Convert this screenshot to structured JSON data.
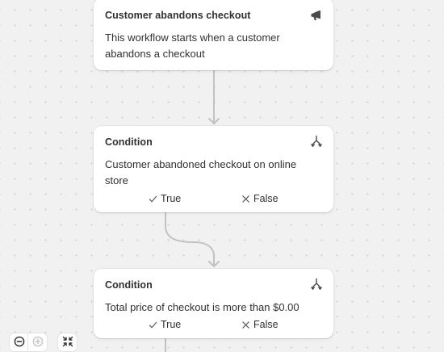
{
  "workflow": {
    "trigger": {
      "title": "Customer abandons checkout",
      "description": "This workflow starts when a customer abandons a checkout",
      "icon": "megaphone-icon"
    },
    "conditions": [
      {
        "title": "Condition",
        "description": "Customer abandoned checkout on online store",
        "icon": "branch-icon",
        "true_label": "True",
        "false_label": "False"
      },
      {
        "title": "Condition",
        "description": "Total price of checkout is more than $0.00",
        "icon": "branch-icon",
        "true_label": "True",
        "false_label": "False"
      }
    ]
  },
  "controls": {
    "zoom_out_icon": "zoom-out-icon",
    "zoom_in_icon": "zoom-in-icon",
    "fit_icon": "fit-to-screen-icon"
  },
  "colors": {
    "canvas": "#f1f1f1",
    "card": "#ffffff",
    "text": "#303030",
    "connector": "#c4c4c4"
  }
}
